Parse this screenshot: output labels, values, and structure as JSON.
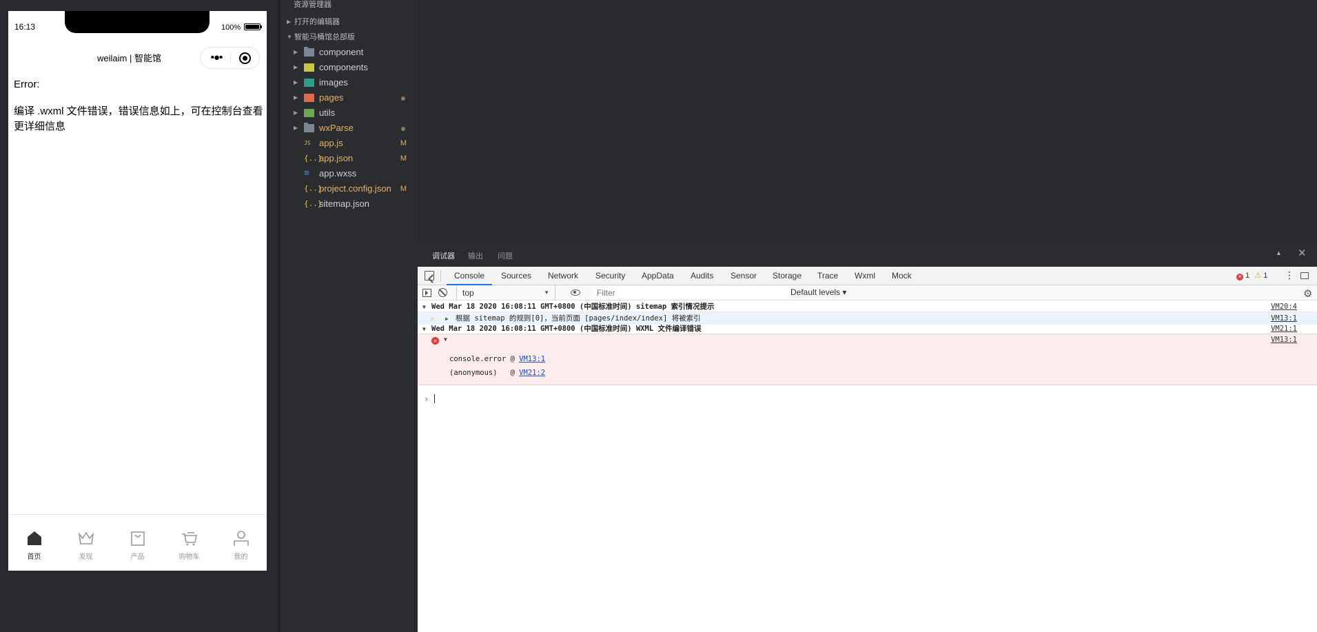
{
  "simulator": {
    "status_time": "16:13",
    "battery_text": "100%",
    "nav_title": "weilaim | 智能馆",
    "more_glyph": "•●•",
    "error_title": "Error:",
    "error_message": "编译 .wxml 文件错误，错误信息如上，可在控制台查看更详细信息",
    "tabs": [
      {
        "label": "首页",
        "icon": "home-icon"
      },
      {
        "label": "发现",
        "icon": "crown-icon"
      },
      {
        "label": "产品",
        "icon": "bag-icon"
      },
      {
        "label": "购物车",
        "icon": "cart-icon"
      },
      {
        "label": "我的",
        "icon": "user-icon"
      }
    ]
  },
  "explorer": {
    "title": "资源管理器",
    "open_editors": "打开的编辑器",
    "project": "智能马桶馆总部版",
    "items": [
      {
        "name": "component",
        "type": "folder"
      },
      {
        "name": "components",
        "type": "folder"
      },
      {
        "name": "images",
        "type": "folder"
      },
      {
        "name": "pages",
        "type": "folder",
        "modified": true
      },
      {
        "name": "utils",
        "type": "folder"
      },
      {
        "name": "wxParse",
        "type": "folder",
        "modified": true
      },
      {
        "name": "app.js",
        "type": "file",
        "status": "M",
        "glyph": "JS"
      },
      {
        "name": "app.json",
        "type": "file",
        "status": "M",
        "glyph": "{..}"
      },
      {
        "name": "app.wxss",
        "type": "file",
        "glyph": "≡"
      },
      {
        "name": "project.config.json",
        "type": "file",
        "status": "M",
        "glyph": "{..}"
      },
      {
        "name": "sitemap.json",
        "type": "file",
        "glyph": "{..}"
      }
    ]
  },
  "debug": {
    "panel_tabs": [
      "调试器",
      "输出",
      "问题"
    ],
    "devtools_tabs": [
      "Console",
      "Sources",
      "Network",
      "Security",
      "AppData",
      "Audits",
      "Sensor",
      "Storage",
      "Trace",
      "Wxml",
      "Mock"
    ],
    "error_count": "1",
    "warning_count": "1",
    "context": "top",
    "filter_placeholder": "Filter",
    "levels": "Default levels ▾",
    "console": {
      "group1_text": "Wed Mar 18 2020 16:08:11 GMT+0800 (中国标准时间) sitemap 索引情况提示",
      "group1_src": "VM20:4",
      "warn_text": "根据 sitemap 的规则[0]，当前页面 [pages/index/index] 将被索引",
      "warn_src": "VM13:1",
      "group2_text": "Wed Mar 18 2020 16:08:11 GMT+0800 (中国标准时间)  WXML 文件编译错误",
      "group2_src": "VM21:1",
      "error_src": "VM13:1",
      "stack1_fn": "console.error @ ",
      "stack1_link": "VM13:1",
      "stack2_fn": "(anonymous)   @ ",
      "stack2_link": "VM21:2"
    }
  },
  "colors": {
    "accent": "#1a73e8",
    "error": "#e23b3b",
    "warning": "#e6a817",
    "modified": "#e0b36a"
  }
}
